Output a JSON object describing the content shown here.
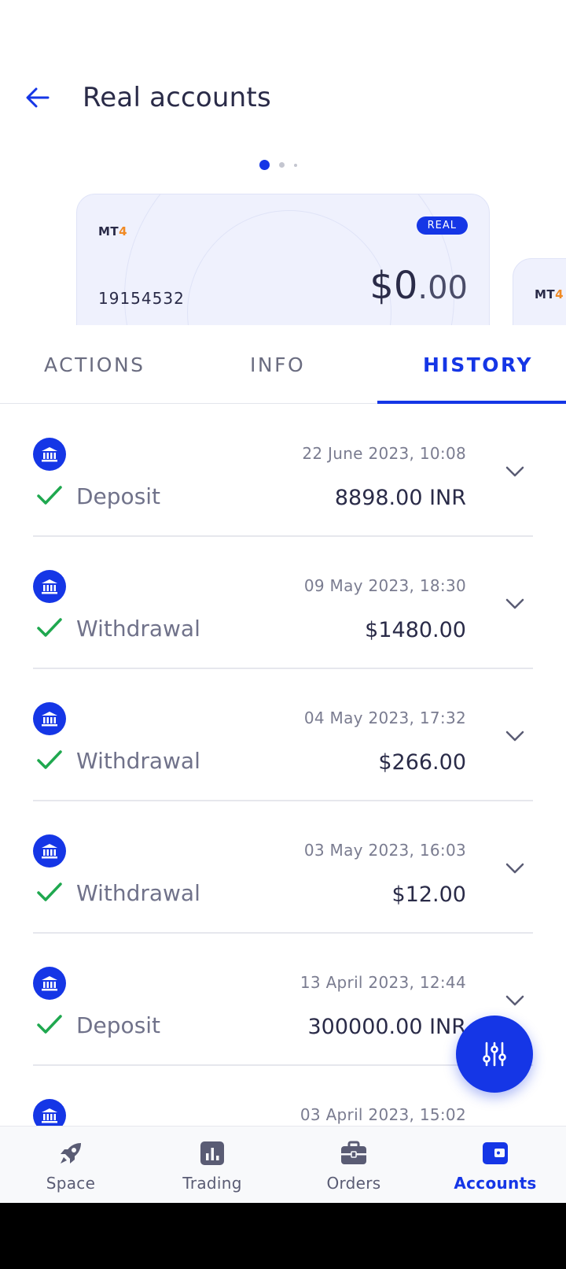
{
  "header": {
    "title": "Real accounts"
  },
  "carousel": {
    "total": 3,
    "active_index": 0
  },
  "account_card": {
    "platform_prefix": "MT",
    "platform_num": "4",
    "badge": "REAL",
    "account_number": "19154532",
    "balance_main": "$0",
    "balance_cents": ".00"
  },
  "next_card": {
    "platform_prefix": "MT",
    "platform_num": "4"
  },
  "tabs": [
    {
      "label": "ACTIONS",
      "active": false
    },
    {
      "label": "INFO",
      "active": false
    },
    {
      "label": "HISTORY",
      "active": true
    }
  ],
  "transactions": [
    {
      "date": "22 June 2023, 10:08",
      "type": "Deposit",
      "amount": "8898.00 INR"
    },
    {
      "date": "09 May 2023, 18:30",
      "type": "Withdrawal",
      "amount": "$1480.00"
    },
    {
      "date": "04 May 2023, 17:32",
      "type": "Withdrawal",
      "amount": "$266.00"
    },
    {
      "date": "03 May 2023, 16:03",
      "type": "Withdrawal",
      "amount": "$12.00"
    },
    {
      "date": "13 April 2023, 12:44",
      "type": "Deposit",
      "amount": "300000.00 INR"
    },
    {
      "date": "03 April 2023, 15:02",
      "type": "",
      "amount": ""
    }
  ],
  "bottom_nav": [
    {
      "label": "Space",
      "icon": "rocket-icon",
      "active": false
    },
    {
      "label": "Trading",
      "icon": "chart-icon",
      "active": false
    },
    {
      "label": "Orders",
      "icon": "briefcase-icon",
      "active": false
    },
    {
      "label": "Accounts",
      "icon": "wallet-icon",
      "active": true
    }
  ],
  "colors": {
    "accent": "#1536e6",
    "success": "#1fa84f",
    "text_primary": "#2a2b48",
    "text_secondary": "#70728a",
    "logo_orange": "#f08a24"
  }
}
